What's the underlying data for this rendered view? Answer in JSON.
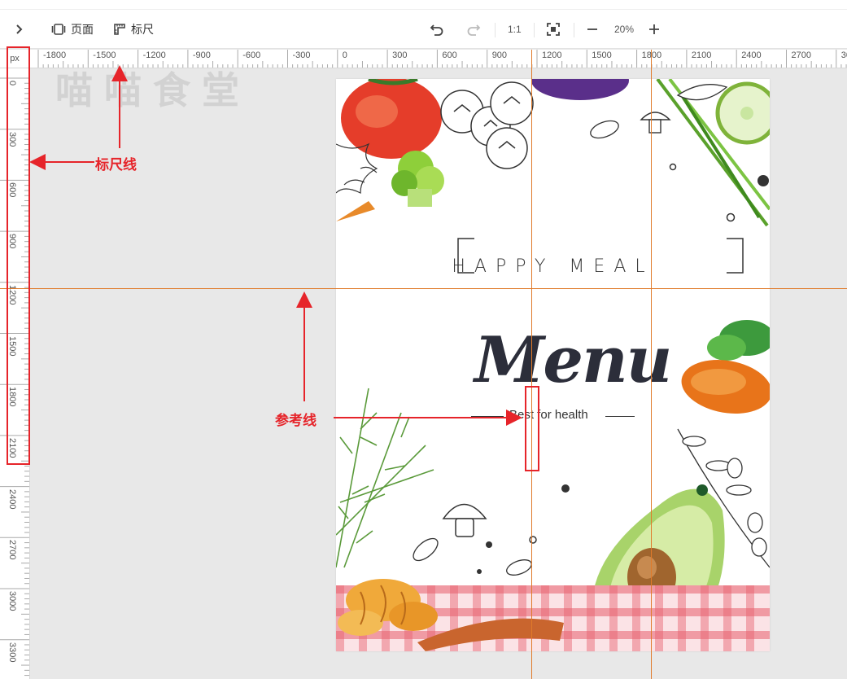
{
  "toolbar": {
    "expand_icon": "chevron-right-icon",
    "page_label": "页面",
    "page_icon": "page-icon",
    "ruler_label": "标尺",
    "ruler_icon": "ruler-icon",
    "undo_icon": "undo-icon",
    "redo_icon": "redo-icon",
    "actual_size_label": "1:1",
    "fit_icon": "fit-screen-icon",
    "zoom_out_icon": "minus-icon",
    "zoom_level": "20%",
    "zoom_in_icon": "plus-icon"
  },
  "ruler": {
    "unit": "px",
    "h_ticks": [
      "-1800",
      "-1500",
      "-1200",
      "-900",
      "-600",
      "-300",
      "0",
      "300",
      "600",
      "900",
      "1200",
      "1500",
      "1800",
      "2100",
      "2400",
      "2700",
      "30"
    ],
    "v_ticks": [
      "0",
      "300",
      "600",
      "900",
      "1200",
      "1500",
      "1800",
      "2100",
      "2400",
      "2700",
      "3000",
      "3300"
    ]
  },
  "canvas": {
    "background_title": "喵喵食堂"
  },
  "poster": {
    "happy_meal": "HAPPY MEAL",
    "menu_title": "Menu",
    "tagline": "Best for health"
  },
  "annotations": {
    "ruler_line_label": "标尺线",
    "guide_line_label": "参考线"
  },
  "colors": {
    "guide_line": "#e07a2a",
    "annotation": "#e6242a",
    "canvas_bg": "#e8e8e8"
  }
}
